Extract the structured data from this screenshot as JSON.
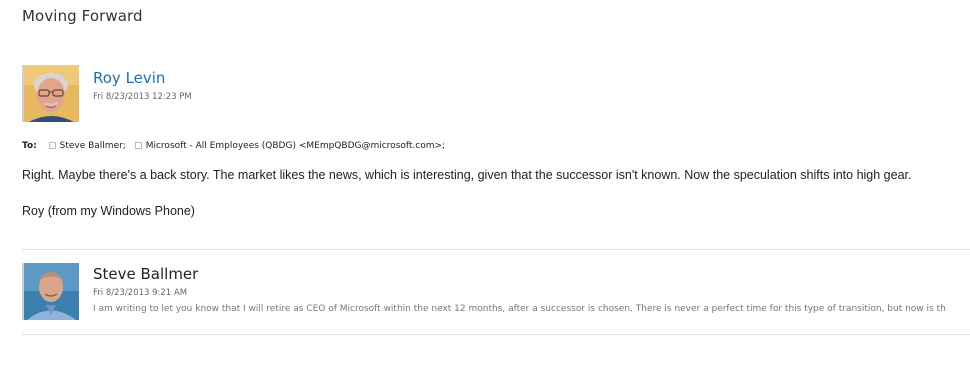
{
  "email": {
    "subject": "Moving Forward",
    "message": {
      "sender": "Roy Levin",
      "date": "Fri 8/23/2013 12:23 PM",
      "to_label": "To:",
      "recipients": [
        "Steve Ballmer;",
        "Microsoft - All Employees (QBDG) <MEmpQBDG@microsoft.com>;"
      ],
      "body_line1": "Right.  Maybe there's a back story.  The market likes the news, which is interesting, given that the successor isn't known.  Now the speculation shifts into high gear.",
      "body_line2": "Roy (from my Windows Phone)"
    },
    "thread": [
      {
        "sender": "Steve Ballmer",
        "date": "Fri 8/23/2013 9:21 AM",
        "preview": "I am writing to let you know that I will retire as CEO of Microsoft within the next 12 months, after a successor is chosen. There is never a perfect time for this type of transition, but now is th"
      }
    ]
  },
  "colors": {
    "sender_link": "#1e6fb8",
    "text": "#222222",
    "muted": "#777777",
    "divider": "#e3e3e3"
  },
  "icons": {
    "avatar1": "person-photo-icon",
    "avatar2": "person-photo-icon",
    "recipient_checkbox": "checkbox-icon"
  }
}
